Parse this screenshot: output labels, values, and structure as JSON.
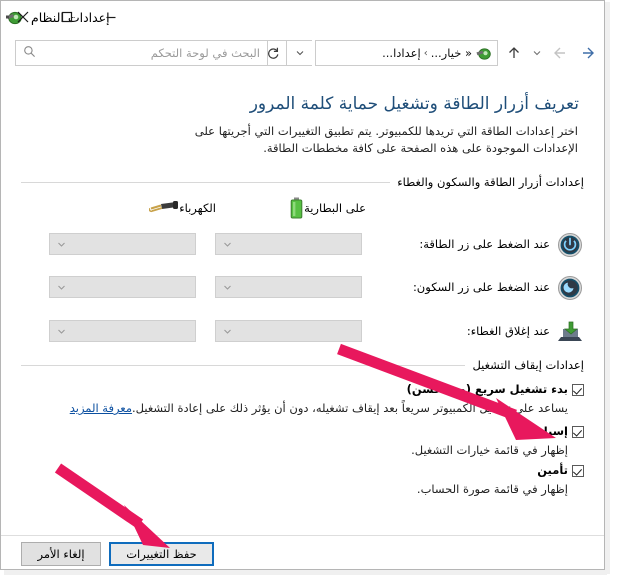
{
  "window": {
    "title": "إعدادات النظام",
    "title_icon": "power-options-icon",
    "caption": {
      "close": "close-icon",
      "maximize": "maximize-icon",
      "minimize": "minimize-icon"
    }
  },
  "nav": {
    "forward_icon": "arrow-forward-icon",
    "back_icon": "arrow-back-icon",
    "recent_icon": "chevron-down-icon",
    "up_icon": "arrow-up-icon",
    "refresh_icon": "refresh-icon",
    "dropdown_icon": "chevron-down-icon",
    "breadcrumb_icon": "power-options-icon",
    "breadcrumb": [
      "« خيار...",
      "إعدادا..."
    ],
    "breadcrumb_sep": "›",
    "search": {
      "placeholder": "البحث في لوحة التحكم",
      "icon": "search-icon"
    }
  },
  "page": {
    "heading": "تعريف أزرار الطاقة وتشغيل حماية كلمة المرور",
    "description": "اختر إعدادات الطاقة التي تريدها للكمبيوتر. يتم تطبيق التغييرات التي أجريتها على الإعدادات الموجودة على هذه الصفحة على كافة مخططات الطاقة."
  },
  "power_group": {
    "title": "إعدادات أزرار الطاقة والسكون والغطاء",
    "columns": [
      {
        "label": "على البطارية",
        "icon": "battery-icon"
      },
      {
        "label": "الكهرباء",
        "icon": "power-plug-icon"
      }
    ],
    "rows": [
      {
        "label": "عند الضغط على زر الطاقة:",
        "icon": "power-button-icon",
        "battery_value": "",
        "plugged_value": "",
        "dropdown_icon": "chevron-down-icon"
      },
      {
        "label": "عند الضغط على زر السكون:",
        "icon": "sleep-button-icon",
        "battery_value": "",
        "plugged_value": "",
        "dropdown_icon": "chevron-down-icon"
      },
      {
        "label": "عند إغلاق الغطاء:",
        "icon": "laptop-lid-icon",
        "battery_value": "",
        "plugged_value": "",
        "dropdown_icon": "chevron-down-icon"
      }
    ]
  },
  "shutdown_group": {
    "title": "إعدادات إيقاف التشغيل",
    "items": [
      {
        "title": "بدء تشغيل سريع (مستحسن)",
        "checked": true,
        "description": "يساعد على تشغيل الكمبيوتر سريعاً بعد إيقاف تشغيله، دون أن يؤثر ذلك على إعادة التشغيل.",
        "link": "معرفة المزيد"
      },
      {
        "title": "إسبات",
        "checked": true,
        "description": "إظهار في قائمة خيارات التشغيل.",
        "link": ""
      },
      {
        "title": "تأمين",
        "checked": true,
        "description": "إظهار في قائمة صورة الحساب.",
        "link": ""
      }
    ]
  },
  "footer": {
    "save_label": "حفظ التغييرات",
    "cancel_label": "إلغاء الأمر"
  },
  "annotations": {
    "arrow_color": "#e8185d",
    "arrow_top_target": "إسبات checkbox",
    "arrow_bottom_target": "حفظ التغييرات button"
  },
  "colors": {
    "heading": "#1f4e79",
    "link": "#0b4fa0",
    "accent_button_border": "#0f6cbd",
    "annotation": "#e8185d"
  }
}
